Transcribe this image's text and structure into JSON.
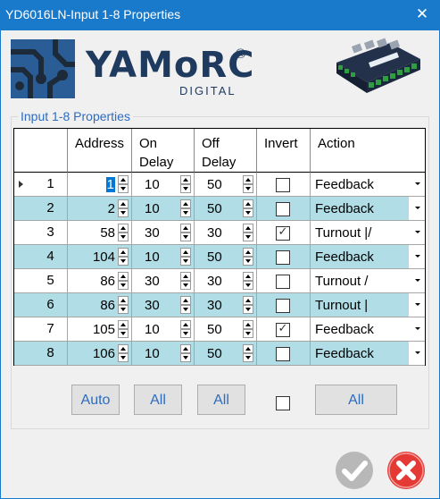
{
  "window": {
    "title": "YD6016LN-Input 1-8 Properties",
    "close_glyph": "✕"
  },
  "brand": {
    "name": "YAMoRC",
    "reg": "®",
    "sub": "DIGITAL",
    "accent": "#1f3a5f",
    "logo_icon": "circuit-board-logo",
    "device_icon": "yd6016ln-device"
  },
  "group": {
    "label": "Input 1-8 Properties"
  },
  "table": {
    "headers": [
      "",
      "Address",
      "On Delay",
      "Off Delay",
      "Invert",
      "Action"
    ],
    "rows": [
      {
        "num": "1",
        "address": "1",
        "on": "10",
        "off": "50",
        "invert": false,
        "action": "Feedback",
        "selected": true
      },
      {
        "num": "2",
        "address": "2",
        "on": "10",
        "off": "50",
        "invert": false,
        "action": "Feedback"
      },
      {
        "num": "3",
        "address": "58",
        "on": "30",
        "off": "30",
        "invert": true,
        "action": "Turnout |/"
      },
      {
        "num": "4",
        "address": "104",
        "on": "10",
        "off": "50",
        "invert": false,
        "action": "Feedback"
      },
      {
        "num": "5",
        "address": "86",
        "on": "30",
        "off": "30",
        "invert": false,
        "action": "Turnout /"
      },
      {
        "num": "6",
        "address": "86",
        "on": "30",
        "off": "30",
        "invert": false,
        "action": "Turnout |"
      },
      {
        "num": "7",
        "address": "105",
        "on": "10",
        "off": "50",
        "invert": true,
        "action": "Feedback"
      },
      {
        "num": "8",
        "address": "106",
        "on": "10",
        "off": "50",
        "invert": false,
        "action": "Feedback"
      }
    ],
    "alt_row_color": "#b0dde6"
  },
  "buttons": {
    "auto": "Auto",
    "on_all": "All",
    "off_all": "All",
    "action_all": "All"
  },
  "dialog": {
    "ok_icon": "checkmark-icon",
    "cancel_icon": "cancel-x-icon"
  }
}
